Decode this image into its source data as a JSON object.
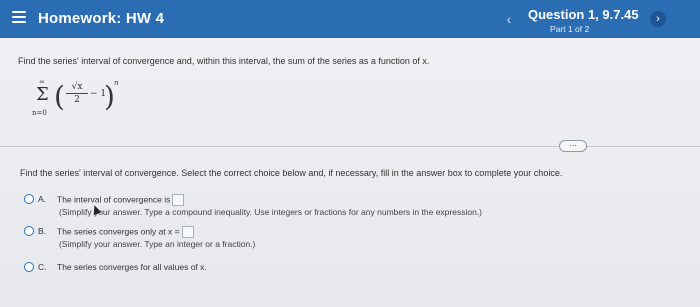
{
  "header": {
    "menu_icon": "menu-icon",
    "homework_title": "Homework: HW 4",
    "question_label": "Question 1, 9.7.45",
    "part_label": "Part 1 of 2",
    "prev_glyph": "‹",
    "next_glyph": "›",
    "bar_color": "#2a6db2"
  },
  "question": {
    "prompt": "Find the series' interval of convergence and, within this interval, the sum of the series as a function of x.",
    "series": {
      "sum_top": "∞",
      "sigma": "Σ",
      "sum_bottom": "n=0",
      "numerator": "√x",
      "denominator": "2",
      "minus": "− 1",
      "exponent": "n",
      "left_paren": "(",
      "right_paren": ")"
    }
  },
  "more_button": "⋯",
  "instruction": "Find the series' interval of convergence. Select the correct choice below and, if necessary, fill in the answer box to complete your choice.",
  "choices": [
    {
      "letter": "A.",
      "text": "The interval of convergence is",
      "hint": "(Simplify your answer. Type a compound inequality. Use integers or fractions for any numbers in the expression.)"
    },
    {
      "letter": "B.",
      "text": "The series converges only at x =",
      "hint": "(Simplify your answer. Type an integer or a fraction.)"
    },
    {
      "letter": "C.",
      "text": "The series converges for all values of x."
    }
  ]
}
